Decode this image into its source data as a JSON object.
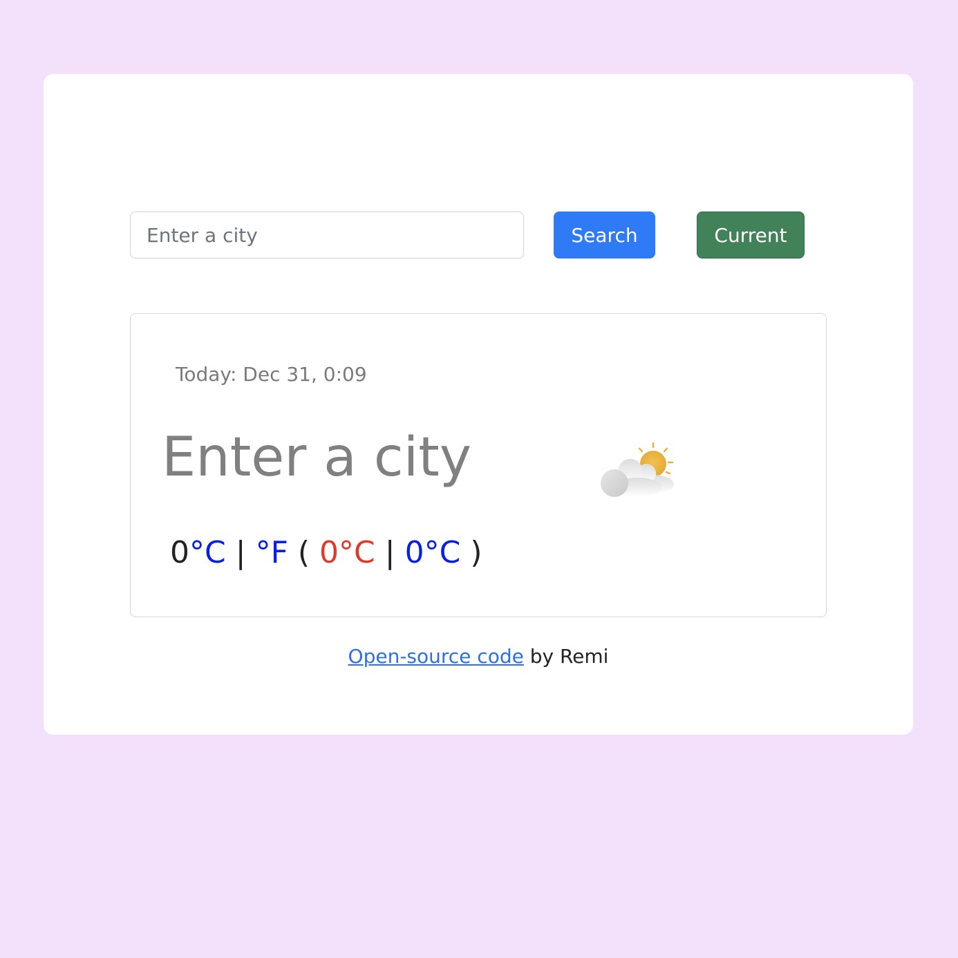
{
  "search": {
    "placeholder": "Enter a city",
    "value": ""
  },
  "buttons": {
    "search_label": "Search",
    "current_label": "Current"
  },
  "weather": {
    "today_label": "Today:",
    "date_time": "Dec 31, 0:09",
    "city": "Enter a city",
    "icon": "partly-cloudy-icon",
    "temperature": "0",
    "unit_celsius": "°C",
    "separator": "|",
    "unit_fahrenheit": "°F",
    "open_paren": "(",
    "max_temp": "0°C",
    "min_temp": "0°C",
    "close_paren": ")"
  },
  "footer": {
    "link_text": "Open-source code",
    "suffix": "by Remi"
  },
  "colors": {
    "background": "#f3e0fa",
    "search_button": "#2f7af6",
    "current_button": "#418258",
    "unit_link": "#0a20e0",
    "max_temp": "#e03a2b",
    "footer_link": "#2e6fe6"
  }
}
